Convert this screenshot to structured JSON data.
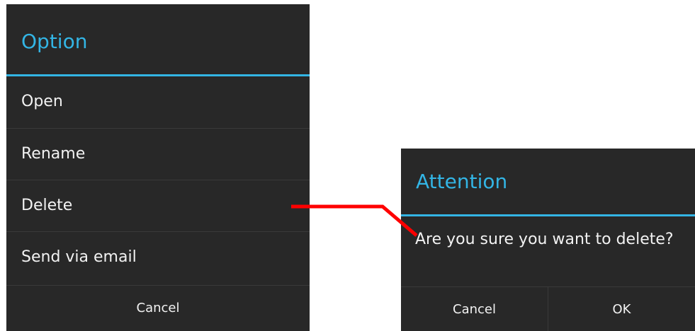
{
  "option_dialog": {
    "title": "Option",
    "items": [
      {
        "label": "Open"
      },
      {
        "label": "Rename"
      },
      {
        "label": "Delete"
      },
      {
        "label": "Send via email"
      }
    ],
    "cancel_label": "Cancel"
  },
  "attention_dialog": {
    "title": "Attention",
    "message": "Are you sure you want to delete?",
    "cancel_label": "Cancel",
    "ok_label": "OK"
  },
  "colors": {
    "dialog_background": "#282828",
    "accent": "#33b5e5",
    "text": "#f2f2f2",
    "connector": "#ff0000"
  }
}
